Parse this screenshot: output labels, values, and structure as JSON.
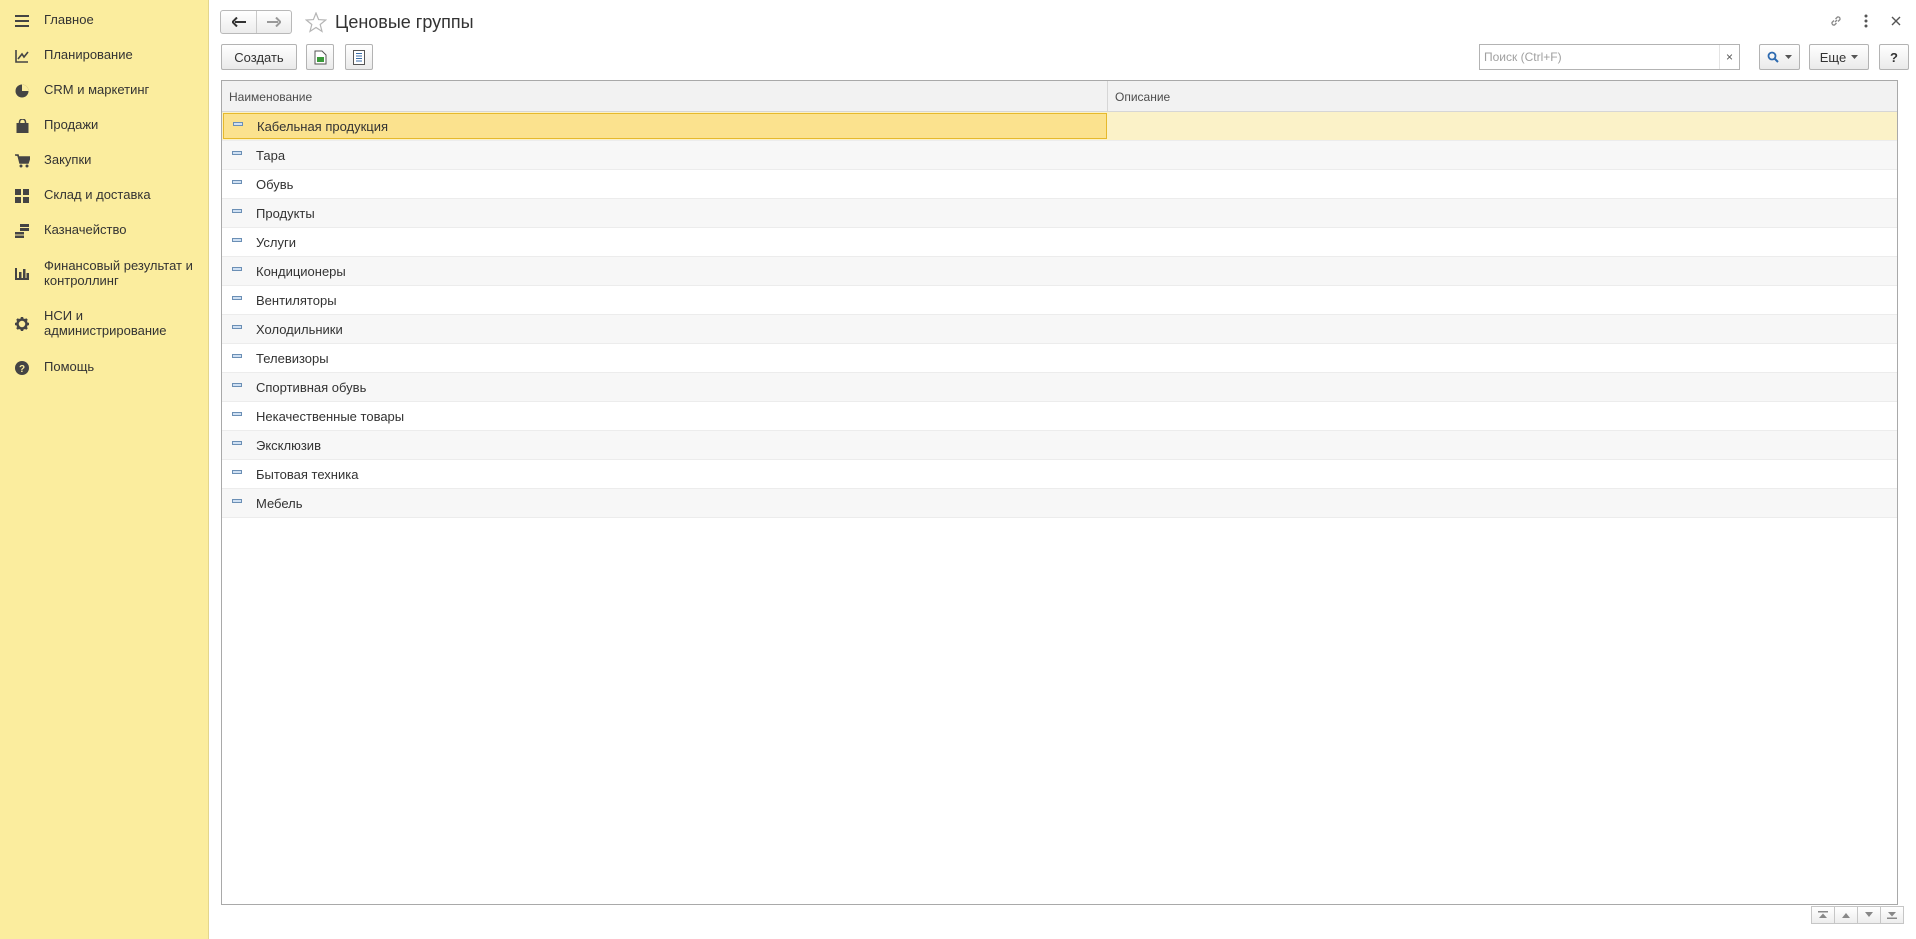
{
  "sidebar": {
    "items": [
      {
        "label": "Главное",
        "icon": "menu-icon"
      },
      {
        "label": "Планирование",
        "icon": "planning-icon"
      },
      {
        "label": "CRM и маркетинг",
        "icon": "pie-chart-icon"
      },
      {
        "label": "Продажи",
        "icon": "shopping-bag-icon"
      },
      {
        "label": "Закупки",
        "icon": "cart-icon"
      },
      {
        "label": "Склад и доставка",
        "icon": "warehouse-grid-icon"
      },
      {
        "label": "Казначейство",
        "icon": "coins-icon"
      },
      {
        "label": "Финансовый результат и контроллинг",
        "icon": "bar-chart-icon"
      },
      {
        "label": "НСИ и администрирование",
        "icon": "gear-icon"
      },
      {
        "label": "Помощь",
        "icon": "question-icon"
      }
    ]
  },
  "header": {
    "title": "Ценовые группы"
  },
  "toolbar": {
    "create_label": "Создать",
    "search_placeholder": "Поиск (Ctrl+F)",
    "search_clear": "×",
    "more_label": "Еще",
    "help_label": "?"
  },
  "table": {
    "columns": [
      "Наименование",
      "Описание"
    ],
    "rows": [
      {
        "name": "Кабельная продукция",
        "desc": ""
      },
      {
        "name": "Тара",
        "desc": ""
      },
      {
        "name": "Обувь",
        "desc": ""
      },
      {
        "name": "Продукты",
        "desc": ""
      },
      {
        "name": "Услуги",
        "desc": ""
      },
      {
        "name": "Кондиционеры",
        "desc": ""
      },
      {
        "name": "Вентиляторы",
        "desc": ""
      },
      {
        "name": "Холодильники",
        "desc": ""
      },
      {
        "name": "Телевизоры",
        "desc": ""
      },
      {
        "name": "Спортивная обувь",
        "desc": ""
      },
      {
        "name": "Некачественные товары",
        "desc": ""
      },
      {
        "name": "Эксклюзив",
        "desc": ""
      },
      {
        "name": "Бытовая техника",
        "desc": ""
      },
      {
        "name": "Мебель",
        "desc": ""
      }
    ],
    "selected_index": 0
  },
  "colors": {
    "sidebar_bg": "#fbed9e",
    "selected_cell": "#fbe28e",
    "selected_row": "#fbf2c8"
  }
}
